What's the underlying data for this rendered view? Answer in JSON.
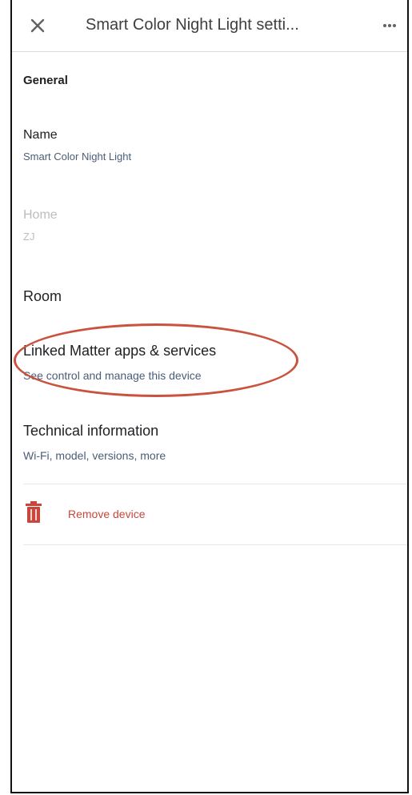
{
  "header": {
    "title": "Smart Color Night Light setti...",
    "close_icon": "close-icon",
    "more_icon": "more-horizontal-icon"
  },
  "general": {
    "section_title": "General",
    "name": {
      "label": "Name",
      "value": "Smart Color Night Light"
    },
    "home": {
      "label": "Home",
      "value": "ZJ"
    },
    "room": {
      "label": "Room"
    },
    "linked": {
      "label": "Linked Matter apps & services",
      "sub": "See control and manage this device"
    },
    "technical": {
      "label": "Technical information",
      "sub": "Wi-Fi, model, versions, more"
    },
    "remove": {
      "label": "Remove device",
      "icon": "trash-icon"
    }
  },
  "colors": {
    "text_primary": "#202124",
    "text_secondary": "#4a5d78",
    "danger": "#c7473d",
    "annotation": "#c9533e"
  }
}
